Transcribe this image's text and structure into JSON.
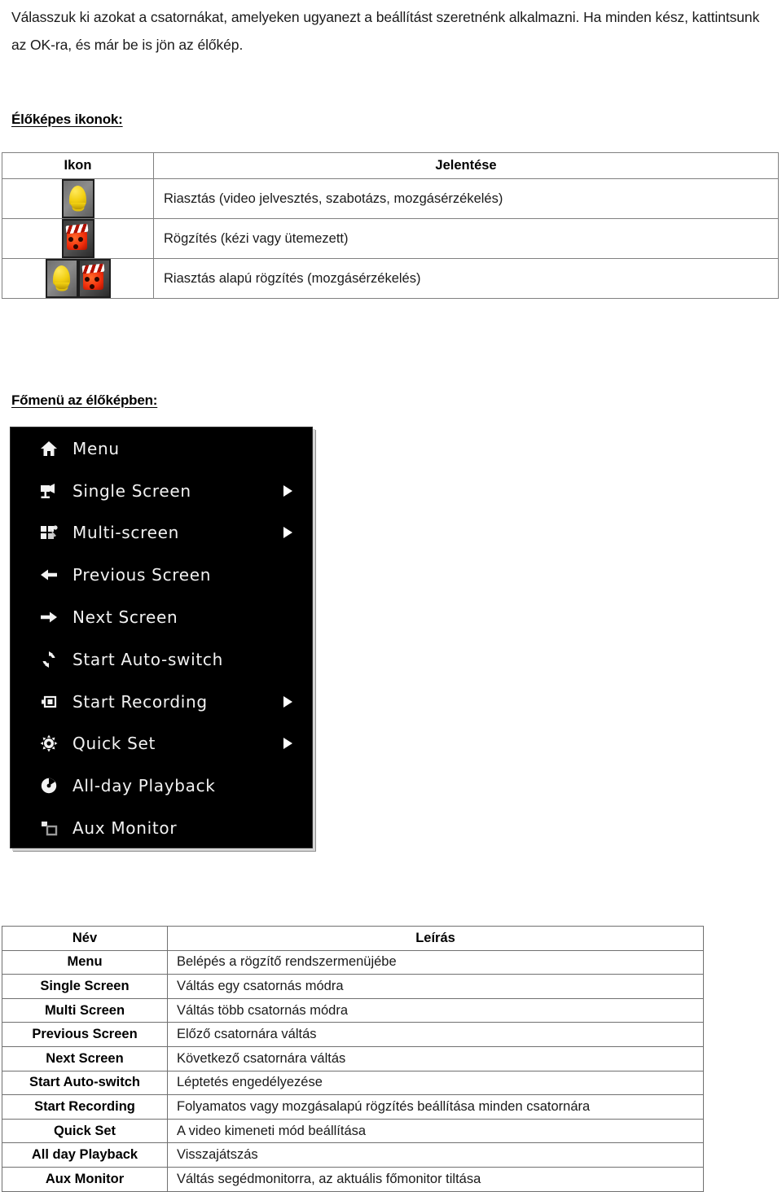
{
  "intro": {
    "paragraph": "Válasszuk ki azokat a csatornákat, amelyeken ugyanezt a beállítást szeretnénk alkalmazni. Ha minden kész, kattintsunk az OK-ra, és már be is jön az élőkép."
  },
  "headings": {
    "icons": "Élőképes ikonok:",
    "main_menu": "Főmenü az élőképben:"
  },
  "icons_table": {
    "headers": {
      "icon": "Ikon",
      "meaning": "Jelentése"
    },
    "rows": [
      {
        "icon_name": "alarm-bell-icon",
        "meaning": "Riasztás (video jelvesztés, szabotázs, mozgásérzékelés)"
      },
      {
        "icon_name": "recording-clapper-icon",
        "meaning": "Rögzítés (kézi vagy ütemezett)"
      },
      {
        "icon_name": "alarm-bell-and-recording-clapper-icon",
        "meaning": "Riasztás alapú rögzítés (mozgásérzékelés)"
      }
    ]
  },
  "dvr_menu": {
    "items": [
      {
        "icon": "home-icon",
        "label": "Menu",
        "has_submenu": false
      },
      {
        "icon": "camera-icon",
        "label": "Single Screen",
        "has_submenu": true
      },
      {
        "icon": "multiscreen-icon",
        "label": "Multi-screen",
        "has_submenu": true
      },
      {
        "icon": "arrow-left-icon",
        "label": "Previous Screen",
        "has_submenu": false
      },
      {
        "icon": "arrow-right-icon",
        "label": "Next Screen",
        "has_submenu": false
      },
      {
        "icon": "refresh-icon",
        "label": "Start Auto-switch",
        "has_submenu": false
      },
      {
        "icon": "camcorder-icon",
        "label": "Start Recording",
        "has_submenu": true
      },
      {
        "icon": "gear-icon",
        "label": "Quick Set",
        "has_submenu": true
      },
      {
        "icon": "playback-disc-icon",
        "label": "All-day Playback",
        "has_submenu": false
      },
      {
        "icon": "aux-monitor-icon",
        "label": "Aux Monitor",
        "has_submenu": false
      }
    ]
  },
  "desc_table": {
    "headers": {
      "name": "Név",
      "description": "Leírás"
    },
    "rows": [
      {
        "name": "Menu",
        "description": "Belépés a rögzítő rendszermenüjébe"
      },
      {
        "name": "Single Screen",
        "description": "Váltás egy csatornás módra"
      },
      {
        "name": "Multi Screen",
        "description": "Váltás több csatornás módra"
      },
      {
        "name": "Previous Screen",
        "description": "Előző csatornára váltás"
      },
      {
        "name": "Next Screen",
        "description": "Következő csatornára váltás"
      },
      {
        "name": "Start Auto-switch",
        "description": "Léptetés engedélyezése"
      },
      {
        "name": "Start Recording",
        "description": "Folyamatos vagy mozgásalapú rögzítés beállítása minden csatornára"
      },
      {
        "name": "Quick Set",
        "description": "A video kimeneti mód beállítása"
      },
      {
        "name": "All day Playback",
        "description": "Visszajátszás"
      },
      {
        "name": "Aux Monitor",
        "description": "Váltás segédmonitorra, az aktuális főmonitor tiltása"
      }
    ]
  },
  "colors": {
    "menu_background": "#000000",
    "menu_text": "#f2f2f2",
    "table_border": "#707070",
    "bell_yellow": "#f2cf12",
    "record_red": "#ef2c0b"
  }
}
